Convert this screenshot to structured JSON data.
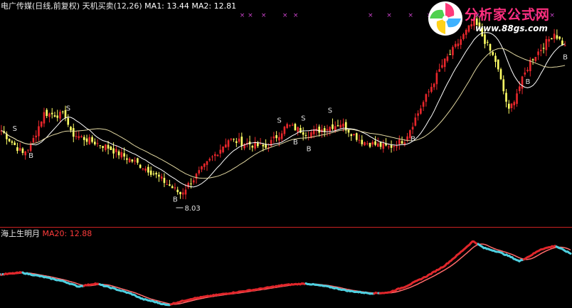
{
  "header_top": {
    "stock": "电广传媒(日线,前复权)",
    "indicator": "天机买卖(12,26)",
    "ma1": "MA1: 13.44",
    "ma2": "MA2: 12.81"
  },
  "header_bottom": {
    "indicator": "海上生明月",
    "ma20": "MA20: 12.88"
  },
  "logo": {
    "site": "分析家公式网",
    "url": "www.88gs.com"
  },
  "colors": {
    "background": "#000000",
    "up": "#e8262b",
    "down": "#ffff66",
    "ma1": "#ffffff",
    "ma2": "#e0d6a0",
    "osc_main": "#e0262b",
    "osc_neg": "#4fd0e0",
    "osc_ref": "#ff6a6a",
    "divider": "#cc2222",
    "marker": "#cc44cc"
  },
  "chart_data": [
    {
      "type": "candlestick",
      "title": "电广传媒(日线,前复权)",
      "y_range": [
        7.2,
        17.6
      ],
      "low_annotation": "8.03",
      "signals": [
        {
          "bar": 5,
          "type": "S"
        },
        {
          "bar": 11,
          "type": "B"
        },
        {
          "bar": 25,
          "type": "S"
        },
        {
          "bar": 65,
          "type": "B"
        },
        {
          "bar": 104,
          "type": "S"
        },
        {
          "bar": 110,
          "type": "B"
        },
        {
          "bar": 113,
          "type": "S"
        },
        {
          "bar": 115,
          "type": "B"
        },
        {
          "bar": 123,
          "type": "S"
        },
        {
          "bar": 154,
          "type": "B"
        },
        {
          "bar": 197,
          "type": "B"
        },
        {
          "bar": 214,
          "type": "B"
        }
      ],
      "markers": [
        90,
        93,
        98,
        106,
        110,
        138,
        145,
        153,
        160,
        169,
        178,
        193,
        197,
        200,
        206
      ],
      "segments": [
        {
          "n": 4,
          "from": 11.9,
          "to": 11.3
        },
        {
          "n": 5,
          "from": 11.3,
          "to": 10.6
        },
        {
          "n": 3,
          "from": 10.6,
          "to": 11.0
        },
        {
          "n": 5,
          "from": 11.0,
          "to": 12.6
        },
        {
          "n": 8,
          "from": 12.6,
          "to": 12.5
        },
        {
          "n": 2,
          "from": 12.5,
          "to": 11.6
        },
        {
          "n": 14,
          "from": 11.6,
          "to": 10.9
        },
        {
          "n": 15,
          "from": 10.9,
          "to": 9.8
        },
        {
          "n": 12,
          "from": 9.8,
          "to": 8.6
        },
        {
          "n": 4,
          "from": 8.6,
          "to": 9.2
        },
        {
          "n": 14,
          "from": 9.2,
          "to": 11.3
        },
        {
          "n": 14,
          "from": 11.3,
          "to": 10.9
        },
        {
          "n": 8,
          "from": 10.9,
          "to": 12.0
        },
        {
          "n": 8,
          "from": 12.0,
          "to": 11.6
        },
        {
          "n": 12,
          "from": 11.6,
          "to": 12.1
        },
        {
          "n": 8,
          "from": 12.1,
          "to": 11.2
        },
        {
          "n": 10,
          "from": 11.2,
          "to": 10.9
        },
        {
          "n": 6,
          "from": 10.9,
          "to": 11.3
        },
        {
          "n": 14,
          "from": 11.3,
          "to": 15.0
        },
        {
          "n": 12,
          "from": 15.0,
          "to": 17.2
        },
        {
          "n": 8,
          "from": 17.2,
          "to": 15.2
        },
        {
          "n": 5,
          "from": 15.2,
          "to": 12.7
        },
        {
          "n": 8,
          "from": 12.7,
          "to": 15.2
        },
        {
          "n": 9,
          "from": 15.2,
          "to": 16.6
        },
        {
          "n": 4,
          "from": 16.6,
          "to": 15.9
        }
      ]
    },
    {
      "type": "line",
      "title": "海上生明月",
      "y_range": [
        -1.25,
        1.05
      ],
      "series": [
        {
          "name": "MA20",
          "value_last": 12.88
        }
      ],
      "points": [
        [
          0,
          -0.15
        ],
        [
          30,
          -0.08
        ],
        [
          60,
          -0.22
        ],
        [
          90,
          -0.38
        ],
        [
          110,
          -0.55
        ],
        [
          135,
          -0.45
        ],
        [
          160,
          -0.62
        ],
        [
          185,
          -0.8
        ],
        [
          200,
          -0.97
        ],
        [
          215,
          -1.05
        ],
        [
          235,
          -1.18
        ],
        [
          250,
          -1.08
        ],
        [
          270,
          -0.96
        ],
        [
          300,
          -0.85
        ],
        [
          330,
          -0.75
        ],
        [
          360,
          -0.65
        ],
        [
          400,
          -0.5
        ],
        [
          430,
          -0.45
        ],
        [
          460,
          -0.55
        ],
        [
          490,
          -0.7
        ],
        [
          520,
          -0.78
        ],
        [
          545,
          -0.76
        ],
        [
          570,
          -0.55
        ],
        [
          600,
          -0.2
        ],
        [
          625,
          0.15
        ],
        [
          645,
          0.55
        ],
        [
          665,
          0.98
        ],
        [
          680,
          0.75
        ],
        [
          700,
          0.62
        ],
        [
          715,
          0.48
        ],
        [
          730,
          0.3
        ],
        [
          745,
          0.48
        ],
        [
          760,
          0.7
        ],
        [
          780,
          0.82
        ],
        [
          803,
          0.55
        ]
      ]
    }
  ]
}
